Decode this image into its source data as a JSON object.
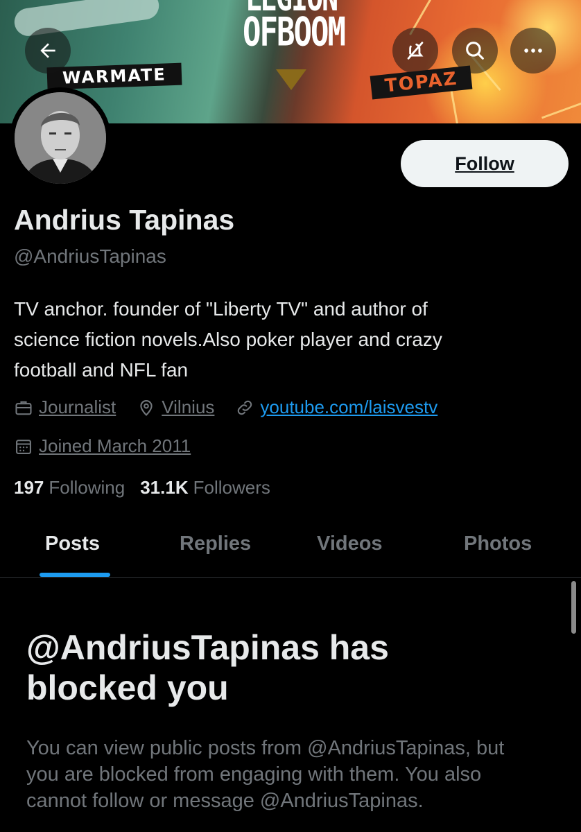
{
  "banner": {
    "left_brand": "WARMATE",
    "center_title_top": "LEGION",
    "center_title_bottom": "OFBOOM",
    "right_brand": "TOPAZ"
  },
  "header": {
    "back_icon": "arrow-left-icon",
    "notifications_icon": "bell-off-icon",
    "search_icon": "search-icon",
    "more_icon": "more-horizontal-icon"
  },
  "profile": {
    "name": "Andrius Tapinas",
    "handle": "@AndriusTapinas",
    "follow_label": "Follow",
    "bio_lines": [
      "TV anchor. founder of \"Liberty TV\" and author of",
      "science fiction novels.Also poker player and crazy",
      "football and NFL fan"
    ],
    "profession": "Journalist",
    "location": "Vilnius",
    "website": "youtube.com/laisvestv",
    "joined": "Joined March 2011",
    "following_count": "197",
    "following_label": "Following",
    "followers_count": "31.1K",
    "followers_label": "Followers"
  },
  "tabs": [
    {
      "label": "Posts",
      "active": true
    },
    {
      "label": "Replies",
      "active": false
    },
    {
      "label": "Videos",
      "active": false
    },
    {
      "label": "Photos",
      "active": false
    }
  ],
  "blocked": {
    "title_line1": "@AndriusTapinas has",
    "title_line2": "blocked you",
    "message_line1": "You can view public posts from @AndriusTapinas, but",
    "message_line2": "you are blocked from engaging with them. You also",
    "message_line3": "cannot follow or message @AndriusTapinas."
  },
  "colors": {
    "background": "#000000",
    "primary_text": "#e7e9ea",
    "secondary_text": "#71767b",
    "accent": "#1d9bf0",
    "follow_button": "#eff3f4"
  }
}
